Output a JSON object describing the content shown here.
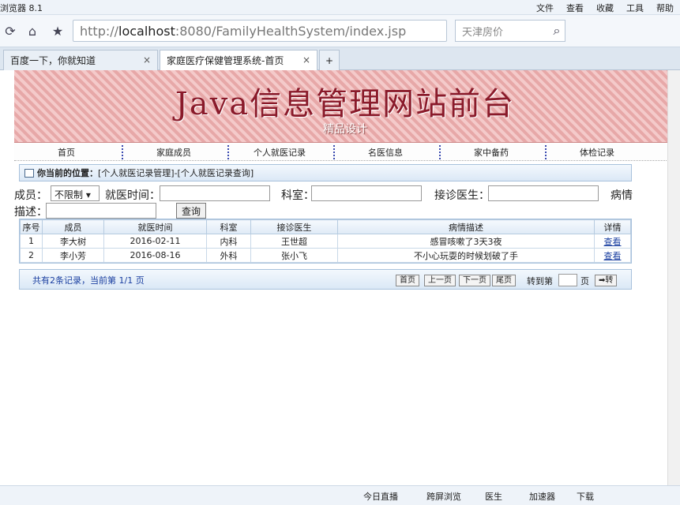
{
  "window": {
    "title": "浏览器 8.1"
  },
  "menu": [
    "文件",
    "查看",
    "收藏",
    "工具",
    "帮助"
  ],
  "address": {
    "url_prefix": "http://",
    "url_host": "localhost",
    "url_rest": ":8080/FamilyHealthSystem/index.jsp",
    "search_placeholder": "天津房价"
  },
  "tabs": [
    {
      "label": "百度一下，你就知道"
    },
    {
      "label": "家庭医疗保健管理系统-首页"
    }
  ],
  "banner": {
    "title": "Java信息管理网站前台",
    "subtitle": "精品设计"
  },
  "nav": [
    "首页",
    "家庭成员",
    "个人就医记录",
    "名医信息",
    "家中备药",
    "体检记录"
  ],
  "crumb": {
    "label": "你当前的位置：",
    "path": "[个人就医记录管理]-[个人就医记录查询]"
  },
  "filters": {
    "member_label": "成员：",
    "member_value": "不限制",
    "date_label": "就医时间：",
    "dept_label": "科室：",
    "doctor_label": "接诊医生：",
    "desc_label_1": "病情",
    "desc_label_2": "描述：",
    "query_button": "查询"
  },
  "table": {
    "headers": [
      "序号",
      "成员",
      "就医时间",
      "科室",
      "接诊医生",
      "病情描述",
      "详情"
    ],
    "rows": [
      [
        "1",
        "李大树",
        "2016-02-11",
        "内科",
        "王世超",
        "感冒咳嗽了3天3夜",
        "查看"
      ],
      [
        "2",
        "李小芳",
        "2016-08-16",
        "外科",
        "张小飞",
        "不小心玩耍的时候划破了手",
        "查看"
      ]
    ]
  },
  "pager": {
    "info": "共有2条记录，当前第 1/1 页",
    "first": "首页",
    "prev": "上一页",
    "next": "下一页",
    "last": "尾页",
    "goto": "转到第",
    "page_unit": "页",
    "go": "➡转"
  },
  "status": [
    "今日直播",
    "跨屏浏览",
    "医生",
    "加速器",
    "下载"
  ]
}
